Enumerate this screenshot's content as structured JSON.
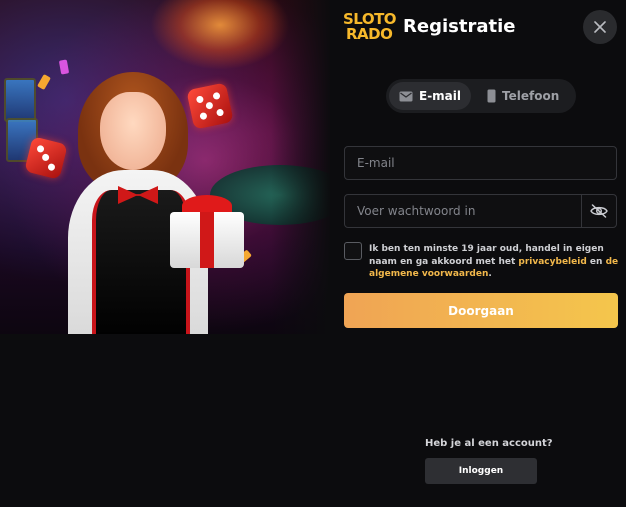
{
  "brand": {
    "logo_line1": "SLOTO",
    "logo_line2": "RADO",
    "logo_color": "#f7b92b"
  },
  "header": {
    "title": "Registratie",
    "close_icon": "close-icon"
  },
  "tabs": [
    {
      "label": "E-mail",
      "icon": "mail-icon",
      "active": true
    },
    {
      "label": "Telefoon",
      "icon": "phone-icon",
      "active": false
    }
  ],
  "form": {
    "email_placeholder": "E-mail",
    "email_value": "",
    "password_placeholder": "Voer wachtwoord in",
    "password_value": "",
    "password_toggle_icon": "eye-off-icon",
    "terms_checked": false,
    "terms_prefix": "Ik ben ten minste 19 jaar oud, handel in eigen naam en ga akkoord met het ",
    "terms_link_privacy": "privacybeleid",
    "terms_middle": " en ",
    "terms_link_conditions": "de algemene voorwaarden",
    "terms_suffix": ".",
    "submit_label": "Doorgaan"
  },
  "footer": {
    "have_account_text": "Heb je al een account?",
    "login_label": "Inloggen"
  },
  "colors": {
    "background": "#0c0c0e",
    "accent_start": "#f0a454",
    "accent_end": "#f4c64c",
    "link": "#f2b84b"
  }
}
